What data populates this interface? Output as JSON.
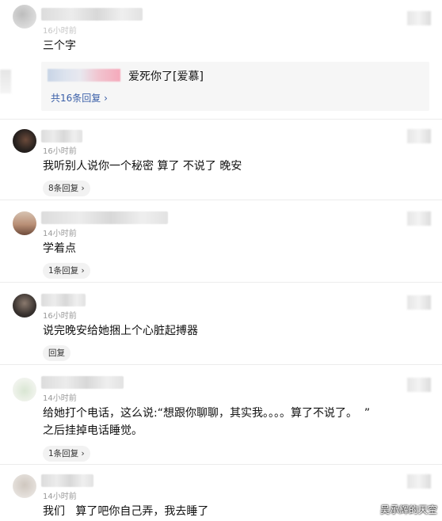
{
  "comments": [
    {
      "time": "16小时前",
      "text": "三个字",
      "nested_reply": {
        "text": "爱死你了[爱慕]",
        "total": "共16条回复"
      }
    },
    {
      "time": "16小时前",
      "text": "我听别人说你一个秘密 算了 不说了 晚安",
      "reply": "8条回复"
    },
    {
      "time": "14小时前",
      "text": "学着点",
      "reply": "1条回复"
    },
    {
      "time": "16小时前",
      "text": "说完晚安给她捆上个心脏起搏器",
      "reply": "回复"
    },
    {
      "time": "14小时前",
      "text": "给她打个电话，这么说:“想跟你聊聊，其实我。。。。算了不说了。  ”",
      "text2": "之后挂掉电话睡觉。",
      "reply": "1条回复"
    },
    {
      "time": "14小时前",
      "text": "我们   算了吧你自己弄，我去睡了"
    }
  ],
  "watermark": "吴承辉的天空",
  "icons": {
    "chevron": "chevron-right-icon"
  }
}
